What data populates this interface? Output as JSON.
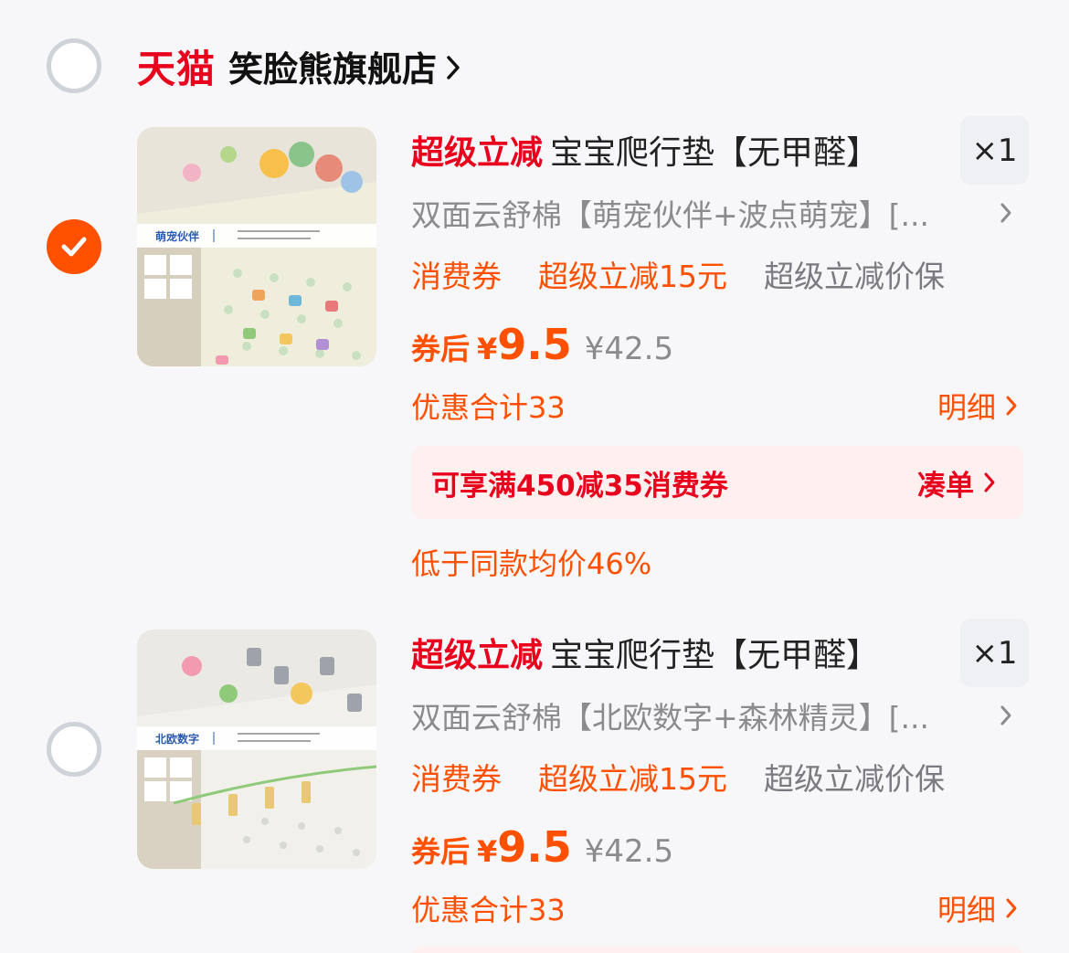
{
  "store": {
    "platform_logo": "天猫",
    "name": "笑脸熊旗舰店",
    "selected": false
  },
  "items": [
    {
      "selected": true,
      "promo_tag": "超级立减",
      "title": "宝宝爬行垫【无甲醛】",
      "quantity": "×1",
      "spec": "双面云舒棉【萌宠伙伴+波点萌宠】[...",
      "tags": [
        "消费券",
        "超级立减15元",
        "超级立减价保"
      ],
      "price_label": "券后",
      "price_currency": "¥",
      "price": "9.5",
      "original_price": "¥42.5",
      "discount_total": "优惠合计33",
      "detail_link": "明细",
      "coupon_text": "可享满450减35消费券",
      "coupon_action": "凑单",
      "note": "低于同款均价46%",
      "image_caption": "萌宠伙伴"
    },
    {
      "selected": false,
      "promo_tag": "超级立减",
      "title": "宝宝爬行垫【无甲醛】",
      "quantity": "×1",
      "spec": "双面云舒棉【北欧数字+森林精灵】[...",
      "tags": [
        "消费券",
        "超级立减15元",
        "超级立减价保"
      ],
      "price_label": "券后",
      "price_currency": "¥",
      "price": "9.5",
      "original_price": "¥42.5",
      "discount_total": "优惠合计33",
      "detail_link": "明细",
      "image_caption": "北欧数字"
    }
  ],
  "colors": {
    "accent": "#ff5000",
    "brand_red": "#e8001c",
    "muted": "#8a8a8f",
    "coupon_bg": "#fff0f0"
  }
}
